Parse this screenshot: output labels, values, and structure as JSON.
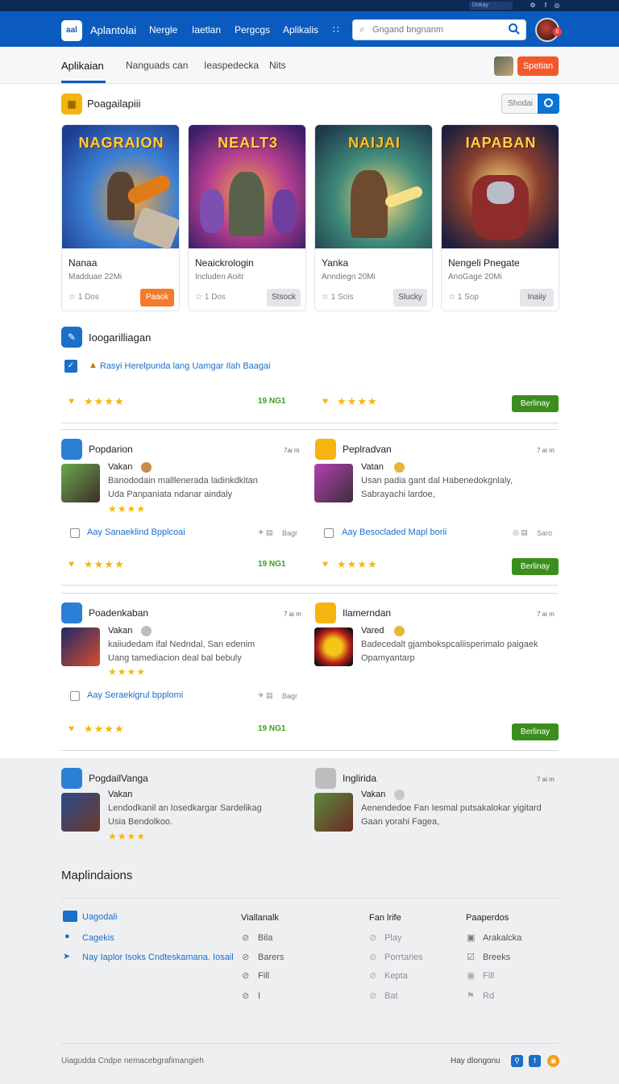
{
  "topstrip": {
    "mini_label": "Dokay",
    "icons": [
      "settings-icon",
      "facebook-icon",
      "globe-icon"
    ]
  },
  "header": {
    "logo": "aal",
    "brand": "Aplantolai",
    "nav": [
      "Nergle",
      "Iaetlan",
      "Pergcgs",
      "Aplikalis"
    ],
    "more": "∷",
    "search_placeholder": "Gngand bngnanm",
    "badge": "6"
  },
  "subnav": {
    "tabs": [
      "Aplikaian",
      "Nanguads can",
      "Ieaspedecka",
      "Nits"
    ],
    "button": "Spetian"
  },
  "section1": {
    "title": "Poagailapiii",
    "segment_label": "Shodai",
    "cards": [
      {
        "art_title": "NAGRAION",
        "name": "Nanaa",
        "sub": "Madduae 22Mi",
        "meta": "☆ 1 Dos",
        "button": "Paaok",
        "button_style": "orange"
      },
      {
        "art_title": "NEALT3",
        "name": "Neaickrologin",
        "sub": "Includen Aoitr",
        "meta": "☆ 1 Dos",
        "button": "Stsock",
        "button_style": "gray"
      },
      {
        "art_title": "NAIJAI",
        "name": "Yanka",
        "sub": "Anndiegn 20Mi",
        "meta": "☆ 1 Sois",
        "button": "Slucky",
        "button_style": "gray"
      },
      {
        "art_title": "IAPABAN",
        "name": "Nengeli Pnegate",
        "sub": "AnoGage 20Mi",
        "meta": "☆ 1 Sop",
        "button": "Inaiiy",
        "button_style": "gray"
      }
    ]
  },
  "section2": {
    "title": "Ioogarilliagan",
    "link": "Rasyi Herelpunda lang Uamgar Ilah Baagai",
    "score": "19 NG1",
    "button": "Berlinay"
  },
  "reviews_row1": [
    {
      "title": "Popdarion",
      "time": "7ai m",
      "user": "Vakan",
      "text1": "Banododain malllenerada ladinkdkitan",
      "text2": "Uda Panpaniata ndanar aindaly",
      "link": "Aay Sanaeklind Bpplcoai",
      "misc": "Bagr"
    },
    {
      "title": "Peplradvan",
      "time": "7 ai m",
      "user": "Vatan",
      "text1": "Usan padia gant dal Habenedokgnlaly,",
      "text2": "Sabrayachi lardoe,",
      "link": "Aay Besocladed Mapl borii",
      "misc": "Saro"
    }
  ],
  "row1_footer": {
    "score": "19 NG1",
    "button": "Berlinay"
  },
  "reviews_row2": [
    {
      "title": "Poadenkaban",
      "time": "7 ai m",
      "user": "Vakan",
      "text1": "kaiiudedam ifal Nedndal, San edenim",
      "text2": "Uang tamediacion deal bal bebuly",
      "link": "Aay Seraekigrul bpplomi",
      "misc": "Bagr"
    },
    {
      "title": "Ilamerndan",
      "time": "7 ai m",
      "user": "Vared",
      "text1": "Badecedalt gjambokspcaliisperimalo paigaek",
      "text2": "Opamyantarp",
      "link": "",
      "misc": ""
    }
  ],
  "row2_footer": {
    "score": "19 NG1",
    "button": "Berlinay"
  },
  "reviews_row3": [
    {
      "title": "PogdailVanga",
      "time": "",
      "user": "Vakan",
      "text1": "Lendodkanil an Iosedkargar Sardelikag",
      "text2": "Usia Bendolkoo."
    },
    {
      "title": "Inglirida",
      "time": "7 ai m",
      "user": "Vakan",
      "text1": "Aenendedoe Fan Iesmal putsakalokar yigitard",
      "text2": "Gaan yorahi Fagea,"
    }
  ],
  "footer": {
    "title": "Maplindaions",
    "col1": [
      "Uagodali",
      "Cagekis",
      "Nay Iaplor Isoks Cndteskamana. Iosail"
    ],
    "col2_head": "Viallanalk",
    "col2": [
      "Bila",
      "Barers",
      "Fill",
      "I"
    ],
    "col3_head": "Fan lrife",
    "col3": [
      "Play",
      "Porrtaries",
      "Kepta",
      "Bat"
    ],
    "col4_head": "Paaperdos",
    "col4": [
      "Arakalcka",
      "Breeks",
      "Fill",
      "Rd"
    ],
    "copyright": "Uiagudda Cndpe nemacebgrafimangieh",
    "social_label": "Hay dlongonu"
  }
}
